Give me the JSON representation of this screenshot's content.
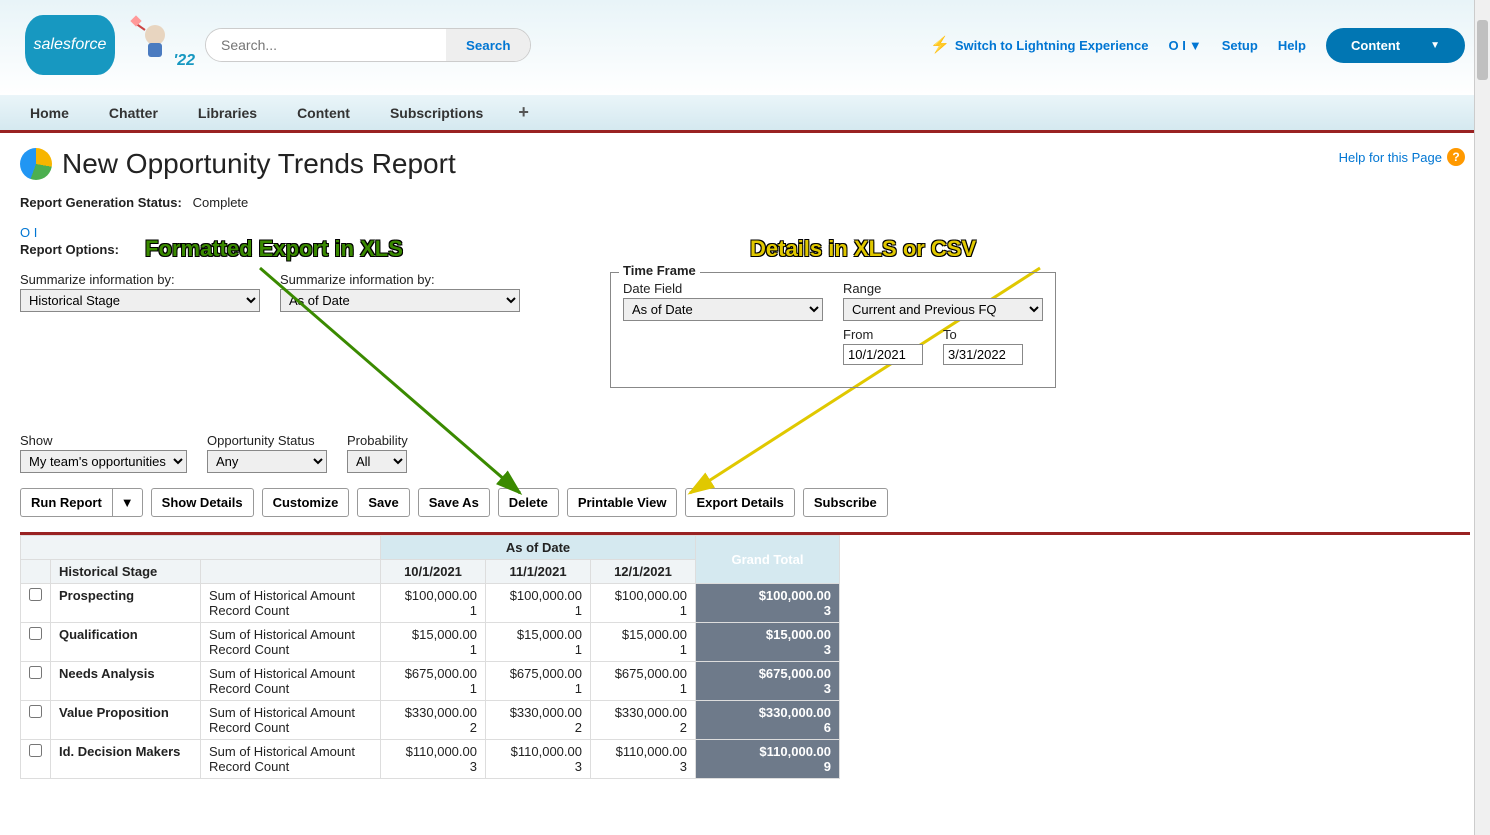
{
  "header": {
    "logo_text": "salesforce",
    "year": "'22",
    "search_placeholder": "Search...",
    "search_button": "Search",
    "lightning": "Switch to Lightning Experience",
    "user": "O I",
    "setup": "Setup",
    "help": "Help",
    "content_pill": "Content"
  },
  "nav": [
    "Home",
    "Chatter",
    "Libraries",
    "Content",
    "Subscriptions"
  ],
  "page": {
    "title": "New Opportunity Trends Report",
    "help_link": "Help for this Page",
    "status_label": "Report Generation Status:",
    "status_value": "Complete",
    "user_link": "O I",
    "options_label": "Report Options:"
  },
  "annotations": {
    "green": "Formatted Export in XLS",
    "yellow": "Details in XLS or CSV"
  },
  "filters": {
    "summarize1_label": "Summarize information by:",
    "summarize1_value": "Historical Stage",
    "summarize2_label": "Summarize information by:",
    "summarize2_value": "As of Date",
    "timeframe_legend": "Time Frame",
    "date_field_label": "Date Field",
    "date_field_value": "As of Date",
    "range_label": "Range",
    "range_value": "Current and Previous FQ",
    "from_label": "From",
    "from_value": "10/1/2021",
    "to_label": "To",
    "to_value": "3/31/2022",
    "show_label": "Show",
    "show_value": "My team's opportunities",
    "opp_status_label": "Opportunity Status",
    "opp_status_value": "Any",
    "prob_label": "Probability",
    "prob_value": "All"
  },
  "buttons": {
    "run_report": "Run Report",
    "show_details": "Show Details",
    "customize": "Customize",
    "save": "Save",
    "save_as": "Save As",
    "delete": "Delete",
    "printable": "Printable View",
    "export_details": "Export Details",
    "subscribe": "Subscribe"
  },
  "table": {
    "as_of_date": "As of Date",
    "grand_total": "Grand Total",
    "historical_stage": "Historical Stage",
    "dates": [
      "10/1/2021",
      "11/1/2021",
      "12/1/2021"
    ],
    "metric1": "Sum of Historical Amount",
    "metric2": "Record Count",
    "rows": [
      {
        "stage": "Prospecting",
        "v": [
          "$100,000.00",
          "$100,000.00",
          "$100,000.00"
        ],
        "c": [
          "1",
          "1",
          "1"
        ],
        "gt_v": "$100,000.00",
        "gt_c": "3"
      },
      {
        "stage": "Qualification",
        "v": [
          "$15,000.00",
          "$15,000.00",
          "$15,000.00"
        ],
        "c": [
          "1",
          "1",
          "1"
        ],
        "gt_v": "$15,000.00",
        "gt_c": "3"
      },
      {
        "stage": "Needs Analysis",
        "v": [
          "$675,000.00",
          "$675,000.00",
          "$675,000.00"
        ],
        "c": [
          "1",
          "1",
          "1"
        ],
        "gt_v": "$675,000.00",
        "gt_c": "3"
      },
      {
        "stage": "Value Proposition",
        "v": [
          "$330,000.00",
          "$330,000.00",
          "$330,000.00"
        ],
        "c": [
          "2",
          "2",
          "2"
        ],
        "gt_v": "$330,000.00",
        "gt_c": "6"
      },
      {
        "stage": "Id. Decision Makers",
        "v": [
          "$110,000.00",
          "$110,000.00",
          "$110,000.00"
        ],
        "c": [
          "3",
          "3",
          "3"
        ],
        "gt_v": "$110,000.00",
        "gt_c": "9"
      }
    ]
  }
}
